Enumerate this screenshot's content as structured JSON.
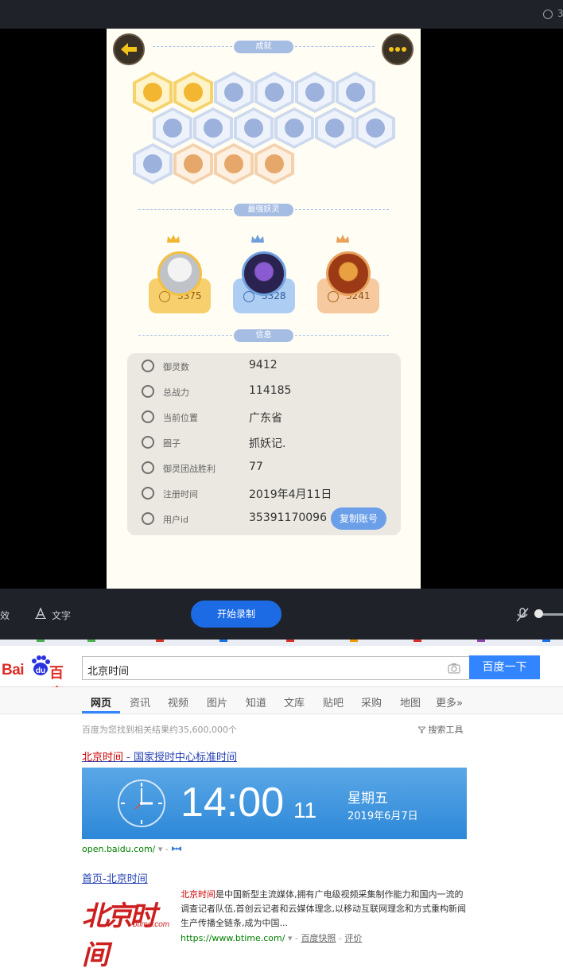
{
  "recorder": {
    "top_right_text": "3",
    "effects_label": "特效",
    "text_label": "文字",
    "start_button": "开始录制"
  },
  "game": {
    "sections": {
      "achievements": "成就",
      "strongest": "最强妖灵",
      "info": "信息"
    },
    "badges": [
      {
        "style": "gold"
      },
      {
        "style": "gold"
      },
      {
        "style": "blue"
      },
      {
        "style": "blue"
      },
      {
        "style": "blue"
      },
      {
        "style": "blue"
      },
      {
        "style": "blue"
      },
      {
        "style": "blue"
      },
      {
        "style": "blue"
      },
      {
        "style": "blue"
      },
      {
        "style": "blue"
      },
      {
        "style": "blue"
      },
      {
        "style": "blue"
      },
      {
        "style": "peach"
      },
      {
        "style": "peach"
      },
      {
        "style": "peach"
      }
    ],
    "spirits": [
      {
        "power": "3375",
        "theme": "gold"
      },
      {
        "power": "3328",
        "theme": "blue"
      },
      {
        "power": "3241",
        "theme": "peach"
      }
    ],
    "info_rows": [
      {
        "label": "御灵数",
        "value": "9412"
      },
      {
        "label": "总战力",
        "value": "114185"
      },
      {
        "label": "当前位置",
        "value": "广东省"
      },
      {
        "label": "圈子",
        "value": "抓妖记."
      },
      {
        "label": "御灵团战胜利",
        "value": "77"
      },
      {
        "label": "注册时间",
        "value": "2019年4月11日"
      },
      {
        "label": "用户id",
        "value": "35391170096"
      }
    ],
    "copy_button": "复制账号"
  },
  "baidu": {
    "logo_left": "Bai",
    "logo_paw": "du",
    "logo_right": "百度",
    "query": "北京时间",
    "search_button": "百度一下",
    "tabs": [
      "网页",
      "资讯",
      "视频",
      "图片",
      "知道",
      "文库",
      "贴吧",
      "采购",
      "地图",
      "更多»"
    ],
    "result_count": "百度为您找到相关结果约35,600,000个",
    "tools": "搜索工具",
    "result1": {
      "title_kw": "北京时间",
      "title_rest": " - 国家授时中心标准时间",
      "time": "14:00",
      "seconds": "11",
      "weekday": "星期五",
      "date": "2019年6月7日",
      "url": "open.baidu.com/",
      "sep": " - "
    },
    "result2": {
      "title_pre": "首页-",
      "title_kw": "北京时间",
      "logo_big": "北京时间",
      "logo_small": "btime.com",
      "snippet_kw": "北京时间",
      "snippet_rest": "是中国新型主流媒体,拥有广电级视频采集制作能力和国内一流的调查记者队伍,首创云记者和云媒体理念,以移动互联网理念和方式重构新闻生产传播全链条,成为中国...",
      "url": "https://www.btime.com/",
      "sep": " - ",
      "cache": "百度快照",
      "sep2": " - ",
      "review": "评价"
    }
  },
  "colors": {
    "gold": "#f7cf6c",
    "blue": "#aecdf2",
    "peach": "#f6c99e",
    "baidu_blue": "#3385ff",
    "link": "#2440b3"
  }
}
